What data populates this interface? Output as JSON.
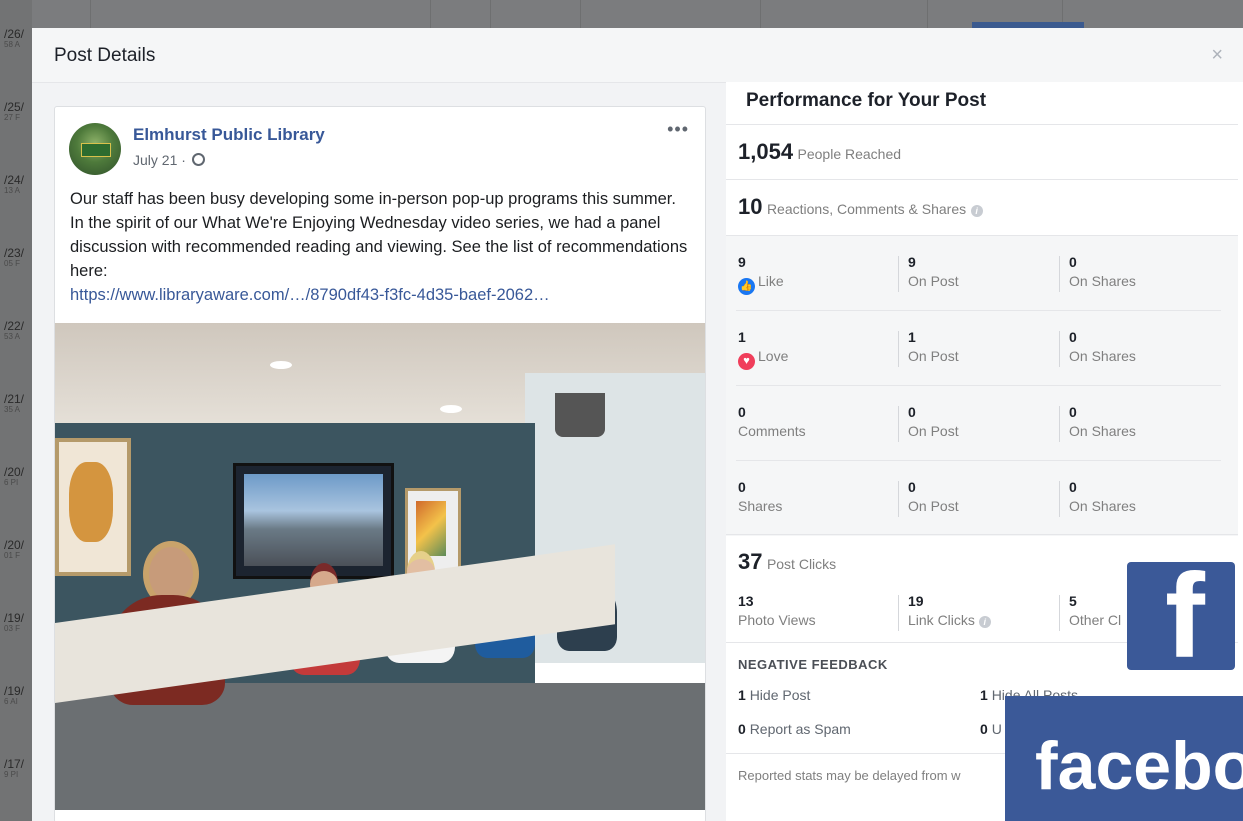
{
  "background": {
    "dates": [
      {
        "date": "/26/",
        "time": "58 A"
      },
      {
        "date": "/25/",
        "time": "27 F"
      },
      {
        "date": "/24/",
        "time": "13 A"
      },
      {
        "date": "/23/",
        "time": "05 F"
      },
      {
        "date": "/22/",
        "time": "53 A"
      },
      {
        "date": "/21/",
        "time": "35 A"
      },
      {
        "date": "/20/",
        "time": "6 PI"
      },
      {
        "date": "/20/",
        "time": "01 F"
      },
      {
        "date": "/19/",
        "time": "03 F"
      },
      {
        "date": "/19/",
        "time": "6 AI"
      },
      {
        "date": "/17/",
        "time": "9 PI"
      }
    ]
  },
  "modal": {
    "title": "Post Details",
    "close": "×"
  },
  "post": {
    "page_name": "Elmhurst Public Library",
    "date": "July 21 ·",
    "more": "•••",
    "text": "Our staff has been busy developing some in-person pop-up programs this summer. In the spirit of our What We're Enjoying Wednesday video series, we had a panel discussion with recommended reading and viewing. See the list of recommendations here:",
    "link": "https://www.libraryaware.com/…/8790df43-f3fc-4d35-baef-2062…"
  },
  "performance": {
    "title": "Performance for Your Post",
    "reached": {
      "value": "1,054",
      "label": "People Reached"
    },
    "engagement": {
      "value": "10",
      "label": "Reactions, Comments & Shares"
    },
    "rows": [
      {
        "n1": "9",
        "l1": "Like",
        "n2": "9",
        "l2": "On Post",
        "n3": "0",
        "l3": "On Shares"
      },
      {
        "n1": "1",
        "l1": "Love",
        "n2": "1",
        "l2": "On Post",
        "n3": "0",
        "l3": "On Shares"
      },
      {
        "n1": "0",
        "l1": "Comments",
        "n2": "0",
        "l2": "On Post",
        "n3": "0",
        "l3": "On Shares"
      },
      {
        "n1": "0",
        "l1": "Shares",
        "n2": "0",
        "l2": "On Post",
        "n3": "0",
        "l3": "On Shares"
      }
    ],
    "clicks": {
      "value": "37",
      "label": "Post Clicks",
      "photo_views": {
        "n": "13",
        "label": "Photo Views"
      },
      "link_clicks": {
        "n": "19",
        "label": "Link Clicks"
      },
      "other_clicks": {
        "n": "5",
        "label": "Other Cl"
      }
    },
    "negative": {
      "heading": "NEGATIVE FEEDBACK",
      "hide_post": {
        "n": "1",
        "label": "Hide Post"
      },
      "hide_all": {
        "n": "1",
        "label": "Hide All Posts"
      },
      "spam": {
        "n": "0",
        "label": "Report as Spam"
      },
      "unlike": {
        "n": "0",
        "label": "U"
      }
    },
    "footer": "Reported stats may be delayed from w"
  },
  "overlays": {
    "square_letter": "f",
    "banner_text": "facebo"
  },
  "colors": {
    "facebook_blue": "#3b5998",
    "link": "#385898",
    "like": "#1a77f2",
    "love": "#f03e5b"
  },
  "icons": [
    "globe-icon",
    "like-icon",
    "love-icon",
    "info-icon",
    "close-icon",
    "more-icon"
  ]
}
